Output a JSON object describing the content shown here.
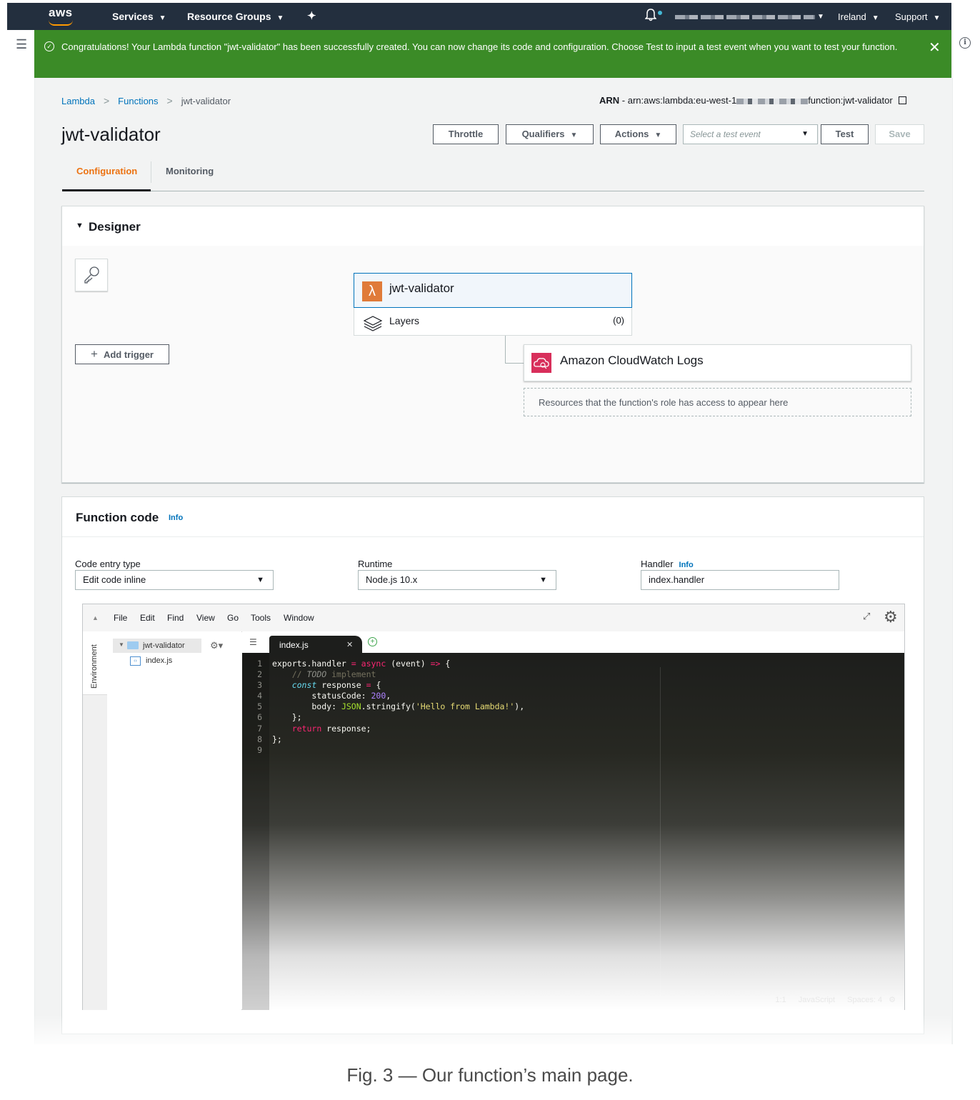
{
  "nav": {
    "logo": "aws",
    "services": "Services",
    "resource_groups": "Resource Groups",
    "region": "Ireland",
    "support": "Support"
  },
  "banner": {
    "message": "Congratulations! Your Lambda function \"jwt-validator\" has been successfully created. You can now change its code and configuration. Choose Test to input a test event when you want to test your function."
  },
  "breadcrumb": {
    "items": [
      "Lambda",
      "Functions",
      "jwt-validator"
    ]
  },
  "arn": {
    "label": "ARN",
    "prefix": " - arn:aws:lambda:eu-west-1",
    "suffix": "function:jwt-validator"
  },
  "page": {
    "title": "jwt-validator"
  },
  "actions": {
    "throttle": "Throttle",
    "qualifiers": "Qualifiers",
    "actions": "Actions",
    "test_event_placeholder": "Select a test event",
    "test": "Test",
    "save": "Save"
  },
  "tabs": [
    {
      "label": "Configuration",
      "active": true
    },
    {
      "label": "Monitoring",
      "active": false
    }
  ],
  "designer": {
    "heading": "Designer",
    "function_name": "jwt-validator",
    "layers_label": "Layers",
    "layers_count": "(0)",
    "add_trigger": "Add trigger",
    "destination": "Amazon CloudWatch Logs",
    "resources_note": "Resources that the function's role has access to appear here"
  },
  "function_code": {
    "heading": "Function code",
    "info": "Info",
    "code_entry_label": "Code entry type",
    "code_entry_value": "Edit code inline",
    "runtime_label": "Runtime",
    "runtime_value": "Node.js 10.x",
    "handler_label": "Handler",
    "handler_info": "Info",
    "handler_value": "index.handler"
  },
  "ide": {
    "menu": [
      "File",
      "Edit",
      "Find",
      "View",
      "Go",
      "Tools",
      "Window"
    ],
    "environment_label": "Environment",
    "folder": "jwt-validator",
    "file": "index.js",
    "tab": "index.js",
    "status": {
      "position": "1:1",
      "language": "JavaScript",
      "spaces": "Spaces: 4"
    },
    "line_numbers": [
      "1",
      "2",
      "3",
      "4",
      "5",
      "6",
      "7",
      "8",
      "9"
    ]
  },
  "caption": "Fig. 3 — Our function’s main page.",
  "colors": {
    "nav_bg": "#232f3e",
    "banner_bg": "#3b8b27",
    "accent_orange": "#ec7211",
    "link_blue": "#0073bb"
  }
}
